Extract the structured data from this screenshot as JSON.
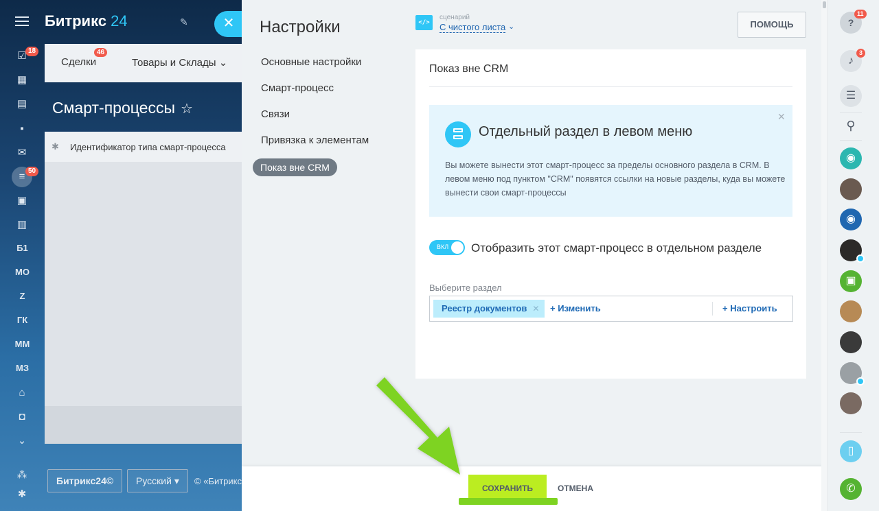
{
  "portal": {
    "logo_main": "Битрикс",
    "logo_num": "24",
    "tabs": [
      {
        "label": "Сделки",
        "badge": "46"
      },
      {
        "label": "Товары и Склады"
      }
    ],
    "tab_chevron": "⌄",
    "page_title": "Смарт-процессы",
    "star": "☆",
    "grid_column": "Идентификатор типа смарт-процесса",
    "footer": {
      "logo": "Битрикс24©",
      "language": "Русский",
      "language_caret": "▾",
      "copyright": "© «Битрикс"
    },
    "nav_badges": {
      "tasks": "18",
      "crm": "50"
    },
    "nav_texts": [
      "Б1",
      "МО",
      "Z",
      "ГК",
      "ММ",
      "МЗ"
    ]
  },
  "slider": {
    "title": "Настройки",
    "scenario_label": "сценарий",
    "scenario_value": "С чистого листа",
    "help_button": "ПОМОЩЬ",
    "menu": [
      "Основные настройки",
      "Смарт-процесс",
      "Связи",
      "Привязка к элементам"
    ],
    "menu_active": "Показ вне CRM",
    "card": {
      "title": "Показ вне CRM",
      "info_title": "Отдельный раздел в левом меню",
      "info_text": "Вы можете вынести этот смарт-процесс за пределы основного раздела в CRM. В левом меню под пунктом \"CRM\" появятся ссылки на новые разделы, куда вы можете вынести свои смарт-процессы",
      "toggle_label": "ВКЛ",
      "toggle_on": true,
      "toggle_text": "Отобразить этот смарт-процесс в отдельном разделе",
      "select_label": "Выберите раздел",
      "selected_tag": "Реестр документов",
      "change_link": "+ Изменить",
      "configure_link": "+ Настроить"
    },
    "save_button": "СОХРАНИТЬ",
    "cancel_button": "ОТМЕНА"
  },
  "rightbar": {
    "help_badge": "11",
    "notifications_badge": "3"
  },
  "colors": {
    "accent": "#2fc6f6",
    "save": "#bbed21",
    "badge": "#f15a4b",
    "link": "#1f6ab5",
    "arrow": "#7ed321"
  }
}
